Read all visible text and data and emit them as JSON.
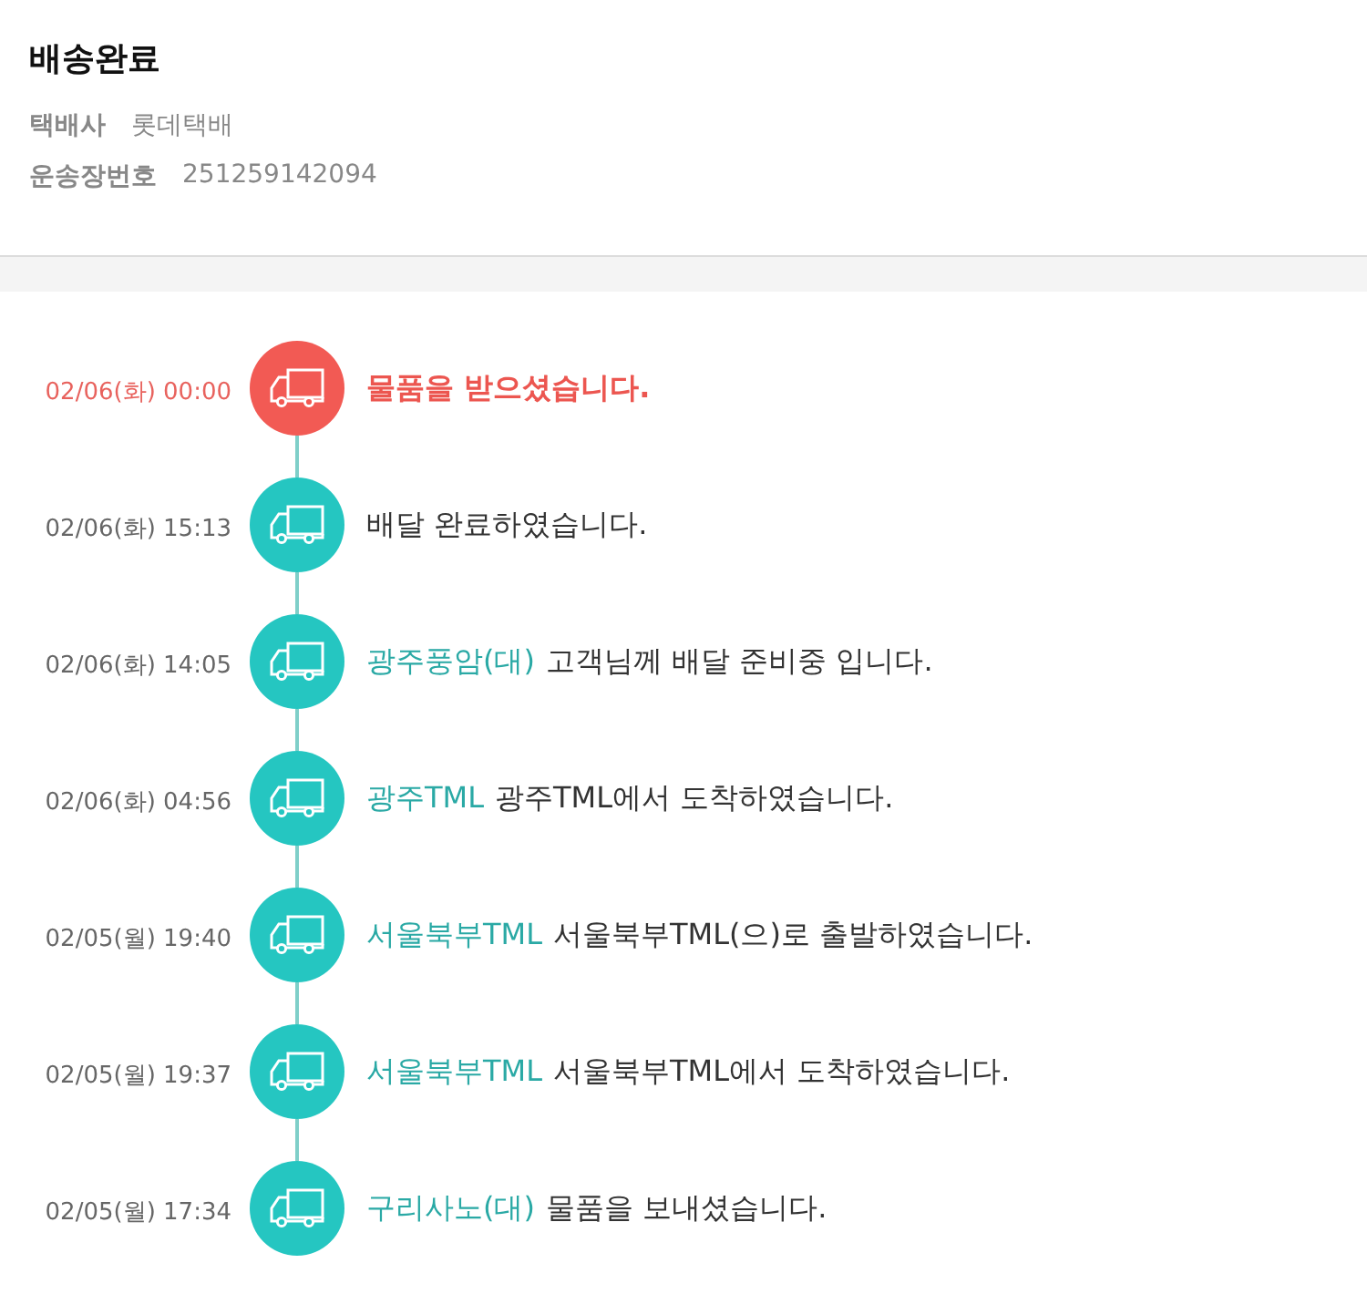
{
  "status_title": "배송완료",
  "info": [
    {
      "label": "택배사",
      "value": "롯데택배"
    },
    {
      "label": "운송장번호",
      "value": "251259142094"
    }
  ],
  "events": [
    {
      "time": "02/06(화) 00:00",
      "message": "물품을 받으셨습니다.",
      "current": true
    },
    {
      "time": "02/06(화) 15:13",
      "message": "배달 완료하였습니다.",
      "current": false
    },
    {
      "time": "02/06(화) 14:05",
      "location": "광주풍암(대)",
      "message": "고객님께 배달 준비중 입니다.",
      "current": false
    },
    {
      "time": "02/06(화) 04:56",
      "location": "광주TML",
      "message": "광주TML에서 도착하였습니다.",
      "current": false
    },
    {
      "time": "02/05(월) 19:40",
      "location": "서울북부TML",
      "message": "서울북부TML(으)로 출발하였습니다.",
      "current": false
    },
    {
      "time": "02/05(월) 19:37",
      "location": "서울북부TML",
      "message": "서울북부TML에서 도착하였습니다.",
      "current": false
    },
    {
      "time": "02/05(월) 17:34",
      "location": "구리사노(대)",
      "message": "물품을 보내셨습니다.",
      "current": false
    }
  ]
}
